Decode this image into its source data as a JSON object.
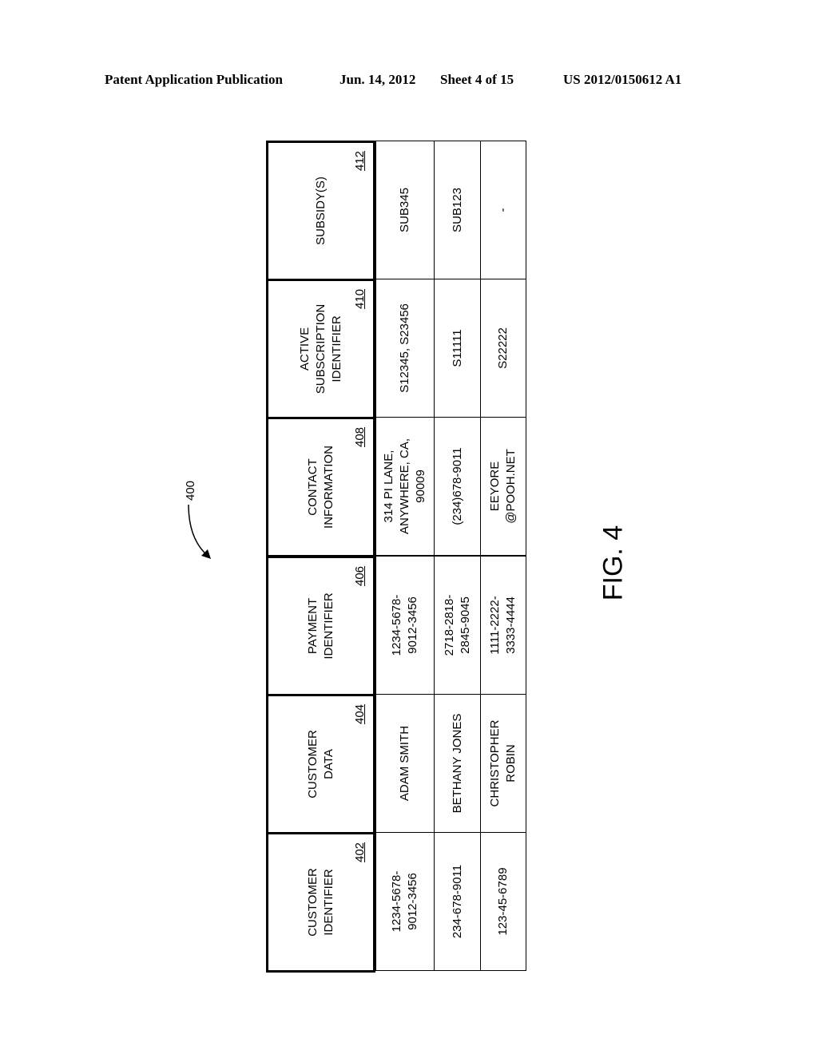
{
  "header": {
    "publication": "Patent Application Publication",
    "date": "Jun. 14, 2012",
    "sheet": "Sheet 4 of 15",
    "number": "US 2012/0150612 A1"
  },
  "figure": {
    "label": "FIG. 4",
    "reference": "400"
  },
  "table": {
    "columns": [
      {
        "title": "CUSTOMER\nIDENTIFIER",
        "ref": "402",
        "values": [
          "1234-5678-\n9012-3456",
          "234-678-9011",
          "123-45-6789"
        ]
      },
      {
        "title": "CUSTOMER\nDATA",
        "ref": "404",
        "values": [
          "ADAM SMITH",
          "BETHANY JONES",
          "CHRISTOPHER\nROBIN"
        ]
      },
      {
        "title": "PAYMENT\nIDENTIFIER",
        "ref": "406",
        "values": [
          "1234-5678-\n9012-3456",
          "2718-2818-\n2845-9045",
          "1111-2222-\n3333-4444"
        ]
      },
      {
        "title": "CONTACT\nINFORMATION",
        "ref": "408",
        "values": [
          "314 PI LANE,\nANYWHERE, CA,\n90009",
          "(234)678-9011",
          "EEYORE\n@POOH.NET"
        ]
      },
      {
        "title": "ACTIVE\nSUBSCRIPTION\nIDENTIFIER",
        "ref": "410",
        "values": [
          "S12345, S23456",
          "S11111",
          "S22222"
        ]
      },
      {
        "title": "SUBSIDY(S)",
        "ref": "412",
        "values": [
          "SUB345",
          "SUB123",
          "-"
        ]
      }
    ]
  }
}
